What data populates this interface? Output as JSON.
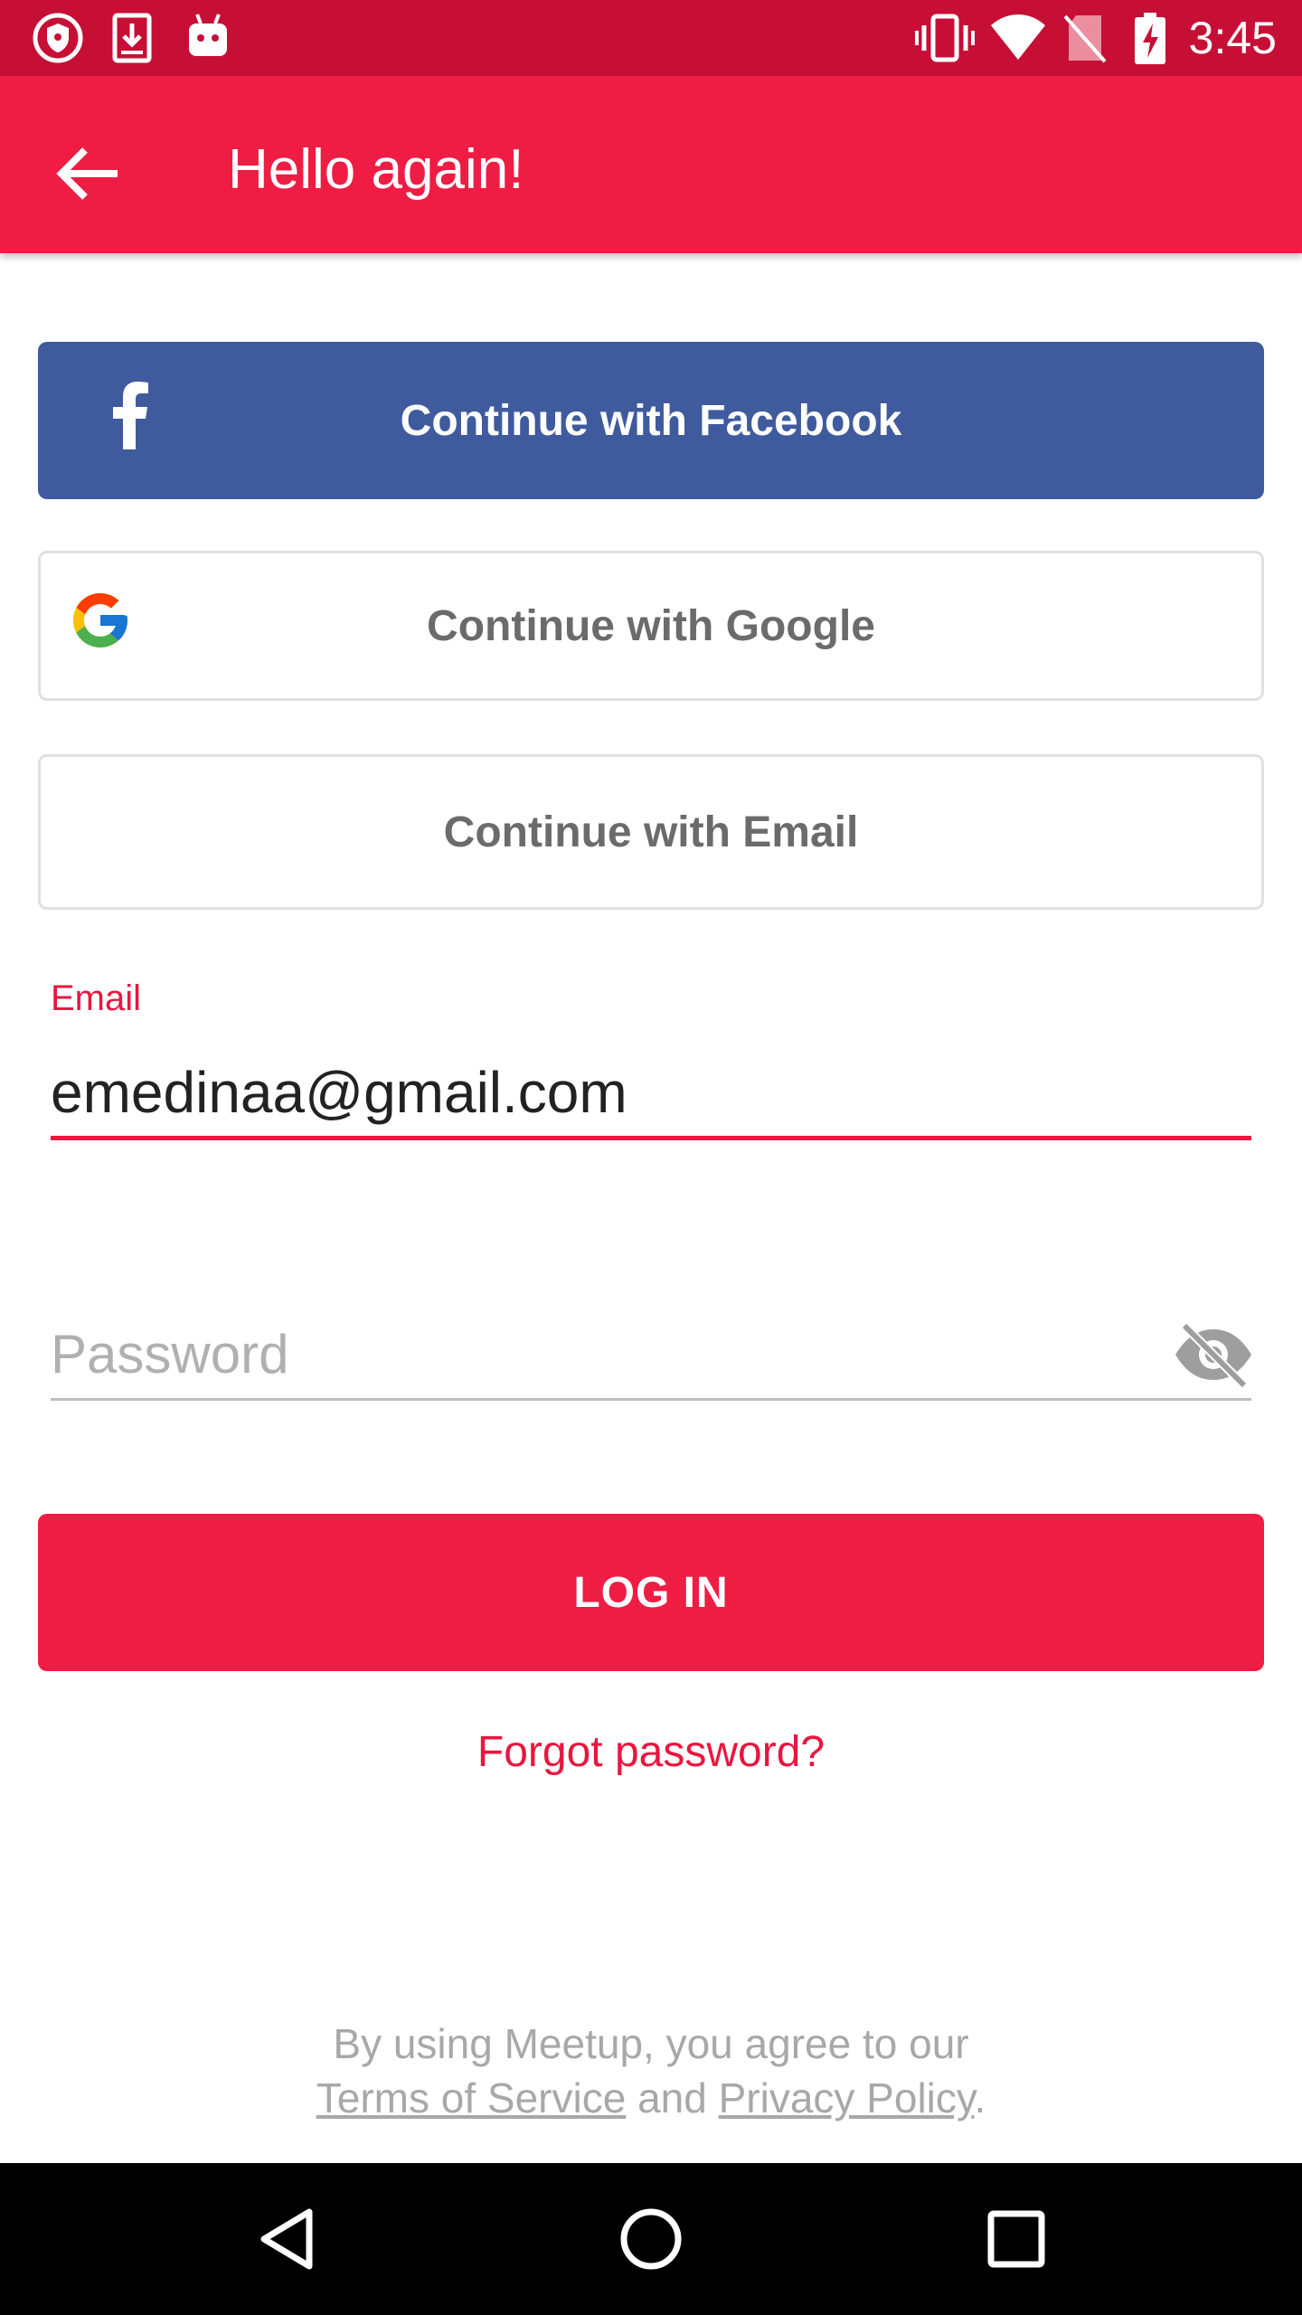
{
  "status_bar": {
    "time": "3:45",
    "left_icons": [
      "shield-icon",
      "download-icon",
      "android-icon"
    ],
    "right_icons": [
      "vibrate-icon",
      "wifi-icon",
      "no-sim-icon",
      "battery-charging-icon"
    ]
  },
  "app_bar": {
    "title": "Hello again!",
    "back_icon": "arrow-back-icon",
    "color": "#ef1c44"
  },
  "social": {
    "facebook_label": "Continue with Facebook",
    "google_label": "Continue with Google",
    "email_label": "Continue with Email",
    "facebook_color": "#3f5b9d"
  },
  "form": {
    "email_label": "Email",
    "email_value": "emedinaa@gmail.com",
    "password_placeholder": "Password",
    "password_icon": "visibility-off-icon",
    "login_label": "LOG IN",
    "forgot_label": "Forgot password?"
  },
  "legal": {
    "line1": "By using Meetup, you agree to our",
    "terms": "Terms of Service",
    "and": "and",
    "privacy": "Privacy Policy",
    "end": "."
  },
  "nav_bar": {
    "icons": [
      "back-triangle-icon",
      "home-circle-icon",
      "recents-square-icon"
    ]
  }
}
